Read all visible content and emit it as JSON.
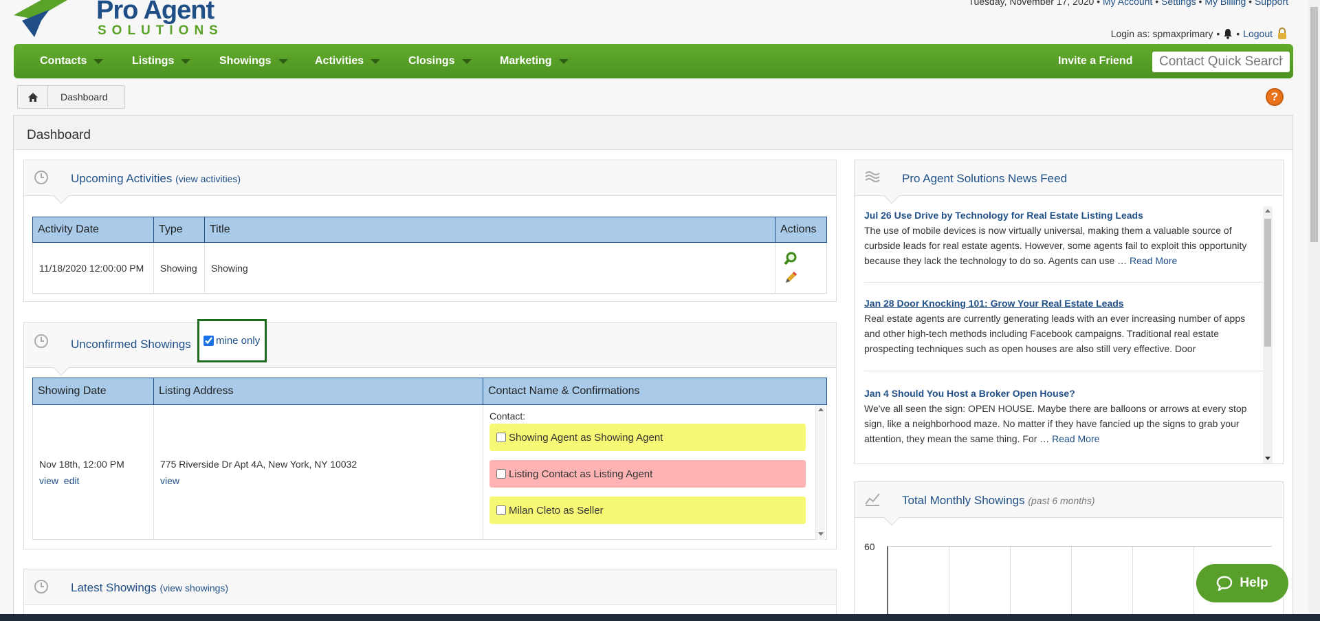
{
  "header": {
    "logo_word1": "Pro Agent",
    "logo_word2": "SOLUTIONS",
    "date": "Tuesday, November 17, 2020",
    "links": [
      "My Account",
      "Settings",
      "My Billing",
      "Support"
    ],
    "login_prefix": "Login as: spmaxprimary",
    "logout": "Logout"
  },
  "nav": {
    "items": [
      "Contacts",
      "Listings",
      "Showings",
      "Activities",
      "Closings",
      "Marketing"
    ],
    "invite": "Invite a Friend",
    "search_placeholder": "Contact Quick Search"
  },
  "breadcrumb": {
    "current": "Dashboard"
  },
  "help_circle": "?",
  "page_title": "Dashboard",
  "upcoming": {
    "title": "Upcoming Activities",
    "sub": "(view activities)",
    "columns": [
      "Activity Date",
      "Type",
      "Title",
      "Actions"
    ],
    "rows": [
      {
        "date": "11/18/2020 12:00:00 PM",
        "type": "Showing",
        "title": "Showing"
      }
    ]
  },
  "unconfirmed": {
    "title": "Unconfirmed Showings",
    "mine_only": "mine only",
    "columns": [
      "Showing Date",
      "Listing Address",
      "Contact Name & Confirmations"
    ],
    "row": {
      "date": "Nov 18th, 12:00 PM",
      "view": "view",
      "edit": "edit",
      "address": "775 Riverside Dr Apt 4A, New York, NY 10032",
      "address_view": "view",
      "contact_label": "Contact:",
      "confirmations": [
        {
          "label": "Showing Agent as Showing Agent",
          "color": "#f8f877"
        },
        {
          "label": "Listing Contact as Listing Agent",
          "color": "#ffb3b3"
        },
        {
          "label": "Milan Cleto as Seller",
          "color": "#f8f877"
        }
      ]
    }
  },
  "latest": {
    "title": "Latest Showings",
    "sub": "(view showings)"
  },
  "news": {
    "title": "Pro Agent Solutions News Feed",
    "read_more": "Read More",
    "items": [
      {
        "title": "Jul 26 Use Drive by Technology for Real Estate Listing Leads",
        "body": "The use of mobile devices is now virtually universal, making them a valuable source of curbside leads for real estate agents. However, some agents fail to exploit this opportunity because they lack the technology to do so. Agents can use …"
      },
      {
        "title": "Jan 28 Door Knocking 101: Grow Your Real Estate Leads",
        "body": "Real estate agents are currently generating leads with an ever increasing number of apps and other high-tech methods including Facebook campaigns. Traditional real estate prospecting techniques such as open houses are also still very effective. Door"
      },
      {
        "title": "Jan 4 Should You Host a Broker Open House?",
        "body": "We've all seen the sign: OPEN HOUSE. Maybe there are balloons or arrows at every stop sign, like a neighborhood maze. No matter if they have fancied up the signs to grab your attention, they mean the same thing. For …"
      }
    ]
  },
  "monthly": {
    "title": "Total Monthly Showings",
    "sub": "(past 6 months)",
    "y_top_label": "60"
  },
  "help_button": "Help",
  "colors": {
    "nav_green": "#58a02a",
    "link_blue": "#1f4f86",
    "header_blue": "#a9cbe9"
  }
}
